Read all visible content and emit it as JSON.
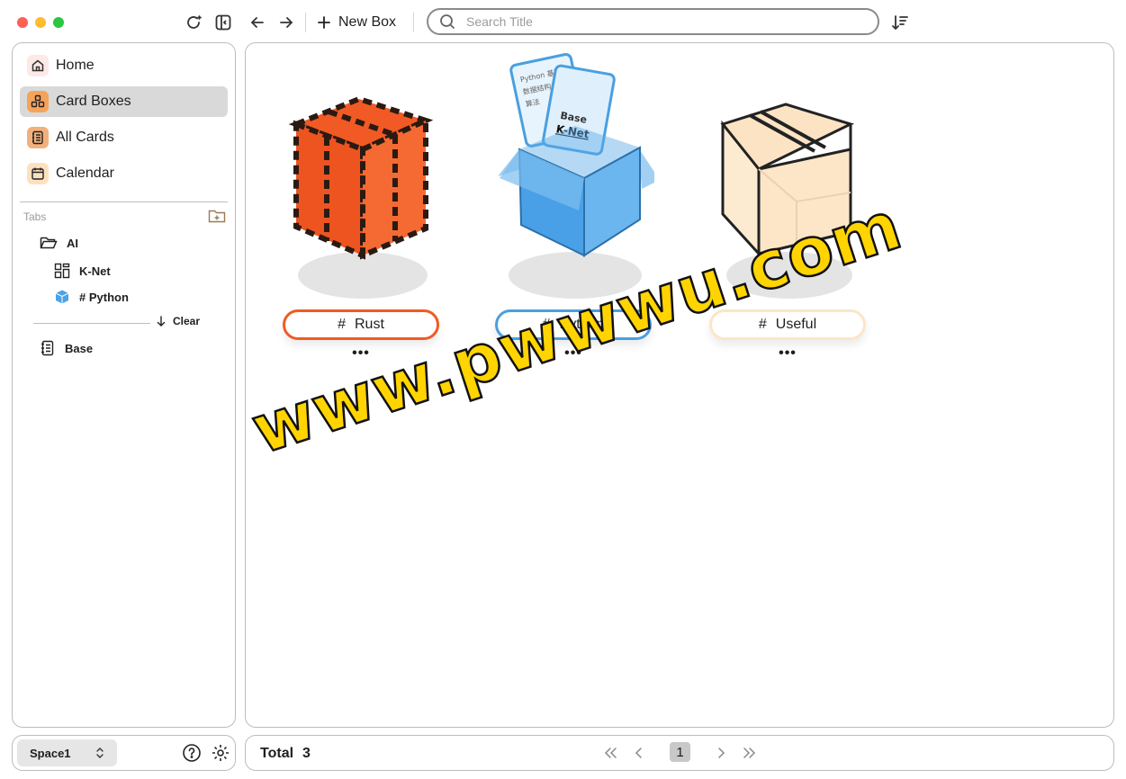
{
  "toolbar": {
    "new_box_label": "New Box",
    "search_placeholder": "Search Title"
  },
  "sidebar": {
    "nav": [
      {
        "label": "Home",
        "icon": "home-icon"
      },
      {
        "label": "Card Boxes",
        "icon": "card-boxes-icon",
        "active": true
      },
      {
        "label": "All Cards",
        "icon": "notebook-icon"
      },
      {
        "label": "Calendar",
        "icon": "calendar-icon"
      }
    ],
    "tabs_label": "Tabs",
    "tree": {
      "folder": "AI",
      "children": [
        "K-Net",
        "# Python"
      ],
      "clear_label": "Clear",
      "base": "Base"
    }
  },
  "boxes": [
    {
      "label": "Rust",
      "hash": "#",
      "color": "#f15a24"
    },
    {
      "label": "Python",
      "hash": "#",
      "color": "#4a9fe0"
    },
    {
      "label": "Useful",
      "hash": "#",
      "color": "#fde5c6"
    }
  ],
  "box_overlay": {
    "card_title": "K-Net",
    "card_lines": [
      "Python 基础",
      "数据结构",
      "算法",
      "Base"
    ]
  },
  "more_label": "•••",
  "space": {
    "name": "Space1"
  },
  "footer": {
    "total_label": "Total",
    "total_value": "3",
    "current_page": "1"
  },
  "watermark": "www.pwwwu.com",
  "colors": {
    "accent_active": "#d9d9d9",
    "rust": "#f15a24",
    "python": "#4a9fe0",
    "useful": "#fde5c6"
  }
}
